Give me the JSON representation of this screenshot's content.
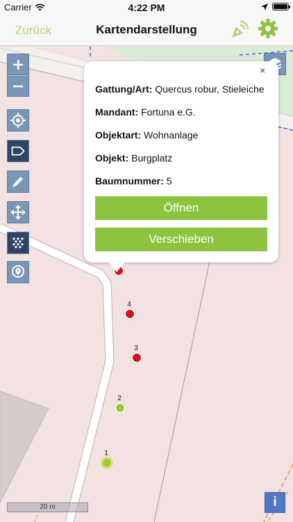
{
  "status_bar": {
    "carrier": "Carrier",
    "time": "4:22 PM"
  },
  "nav": {
    "back_label": "Zurück",
    "title": "Kartendarstellung"
  },
  "colors": {
    "accent_green": "#8cc33f",
    "back_green": "#b9d37a",
    "marker_red": "#d2131b",
    "marker_green": "#9bcb3b",
    "tool_blue": "#7a95b6",
    "tool_active": "#2f4565",
    "info_blue": "#4f78c6"
  },
  "map_tools": [
    {
      "name": "zoom-in",
      "icon": "plus-icon",
      "label": "+"
    },
    {
      "name": "zoom-out",
      "icon": "minus-icon",
      "label": "−"
    },
    {
      "name": "locate",
      "icon": "crosshair-icon"
    },
    {
      "name": "label-toggle",
      "icon": "tag-icon",
      "active": true
    },
    {
      "name": "edit",
      "icon": "pencil-icon"
    },
    {
      "name": "move",
      "icon": "move-arrows-icon"
    },
    {
      "name": "cluster",
      "icon": "dots-grid-icon",
      "active": true
    },
    {
      "name": "pin",
      "icon": "location-pin-icon"
    }
  ],
  "popup": {
    "close_label": "×",
    "fields": [
      {
        "key": "Gattung/Art:",
        "value": "Quercus robur, Stieleiche"
      },
      {
        "key": "Mandant:",
        "value": "Fortuna e.G."
      },
      {
        "key": "Objektart:",
        "value": "Wohnanlage"
      },
      {
        "key": "Objekt:",
        "value": "Burgplatz"
      },
      {
        "key": "Baumnummer:",
        "value": "5"
      }
    ],
    "open_label": "Öffnen",
    "move_label": "Verschieben"
  },
  "markers": [
    {
      "number": "",
      "status": "red"
    },
    {
      "number": "4",
      "status": "red"
    },
    {
      "number": "3",
      "status": "red"
    },
    {
      "number": "2",
      "status": "green"
    },
    {
      "number": "1",
      "status": "green"
    }
  ],
  "scale": {
    "label": "20 m"
  },
  "info_button": {
    "label": "i"
  }
}
